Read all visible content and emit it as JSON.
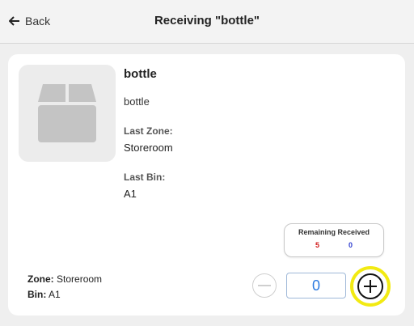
{
  "header": {
    "back_label": "Back",
    "title": "Receiving \"bottle\""
  },
  "item": {
    "icon": "box-icon",
    "name": "bottle",
    "description": "bottle",
    "last_zone_label": "Last Zone:",
    "last_zone": "Storeroom",
    "last_bin_label": "Last Bin:",
    "last_bin": "A1"
  },
  "summary": {
    "header": "Remaining Received",
    "remaining": "5",
    "received": "0",
    "remaining_color": "#d11a1a",
    "received_color": "#2d3ccf"
  },
  "location": {
    "zone_label": "Zone:",
    "zone": "Storeroom",
    "bin_label": "Bin:",
    "bin": "A1"
  },
  "quantity": {
    "value": "0"
  },
  "colors": {
    "highlight": "#f2ea12",
    "accent": "#2d7be0"
  }
}
